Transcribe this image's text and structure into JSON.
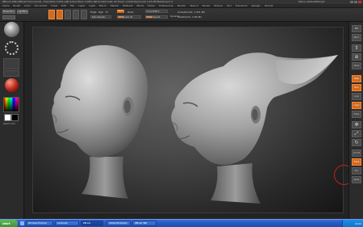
{
  "titlebar": {
    "app": "ZBrush",
    "title": "ZBrush 4R6 [ZBrush Document]   -   Free Mem 3.052+GB   Active Mem 1.085+GB   Scratch Disk 44   Timer: 0.018   PolyCount 1.43 MP   MeshCount 2",
    "right": "Menus  DefaultZScript"
  },
  "menubar": {
    "items": [
      "Alpha",
      "Brush",
      "Color",
      "Document",
      "Draw",
      "Edit",
      "File",
      "Layer",
      "Light",
      "Macro",
      "Marker",
      "Material",
      "Movie",
      "Picker",
      "Preferences",
      "Render",
      "Stencil",
      "Stroke",
      "Texture",
      "Tool",
      "Transform",
      "Zplugin",
      "Zscript"
    ]
  },
  "shelf": {
    "btn_projection": "Projection Master",
    "btn_lightbox": "LightBox",
    "mode_buttons": [
      "Edit",
      "Draw",
      "Move",
      "Scale",
      "Rotate"
    ],
    "mrgb": "Mrgb",
    "rgb": "Rgb",
    "m": "M",
    "zadd": "Zadd",
    "zsub": "Zsub",
    "rgb_intensity": "Rgb Intensity",
    "z_intensity": "Z Intensity 25",
    "focal_shift": "Focal Shift 0",
    "draw_size": "Draw Size 64",
    "active_points": "ActivePoints: 1.431 Mil",
    "total_points": "TotalPoints: 2.86 Mil",
    "dynamic": "Dynamic"
  },
  "left_tray": {
    "swatch_label": "Switch Color"
  },
  "right_tray": {
    "buttons": [
      "BPR",
      "SPix 3",
      "Scroll",
      "Zoom",
      "Actual",
      "AAHalf",
      "Persp",
      "Floor",
      "Local",
      "L.Sym",
      "Frame",
      "Move",
      "Scale",
      "Rotate",
      "Line Fill",
      "Transp",
      "Solo",
      "Xpose"
    ]
  },
  "canvas": {
    "brush_color": "#c22020"
  },
  "taskbar": {
    "start": "start",
    "tasks": [
      "Windows Explorer",
      "LeoSculpt",
      "ZBrush",
      "Adobe Photoshop",
      "ZBrush 4R6"
    ],
    "clock": "10:24"
  }
}
